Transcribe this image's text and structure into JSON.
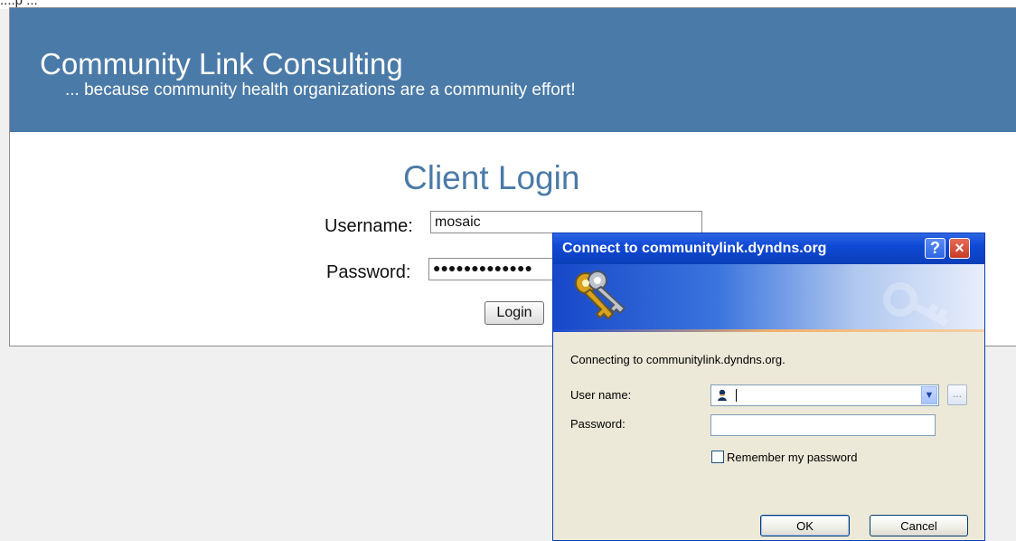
{
  "top": {
    "clipped_text": "....p ..."
  },
  "header": {
    "title": "Community Link Consulting",
    "tagline": "... because community health organizations are a community effort!"
  },
  "login": {
    "title": "Client Login",
    "username_label": "Username:",
    "username_value": "mosaic",
    "password_label": "Password:",
    "password_mask": "●●●●●●●●●●●●●",
    "button_label": "Login"
  },
  "dialog": {
    "title": "Connect to communitylink.dyndns.org",
    "connecting_text": "Connecting to communitylink.dyndns.org.",
    "user_name_label": "User name:",
    "password_label": "Password:",
    "remember_label": "Remember my password",
    "ok_label": "OK",
    "cancel_label": "Cancel",
    "help_symbol": "?",
    "close_symbol": "×",
    "ellipsis": "...",
    "dropdown_symbol": "▼",
    "icons": {
      "help": "help-icon",
      "close": "close-icon",
      "keys": "keys-icon",
      "user": "user-icon"
    }
  },
  "colors": {
    "header_blue": "#4a7aa8",
    "dialog_blue": "#0f49d6",
    "dialog_background": "#ece9d8"
  }
}
